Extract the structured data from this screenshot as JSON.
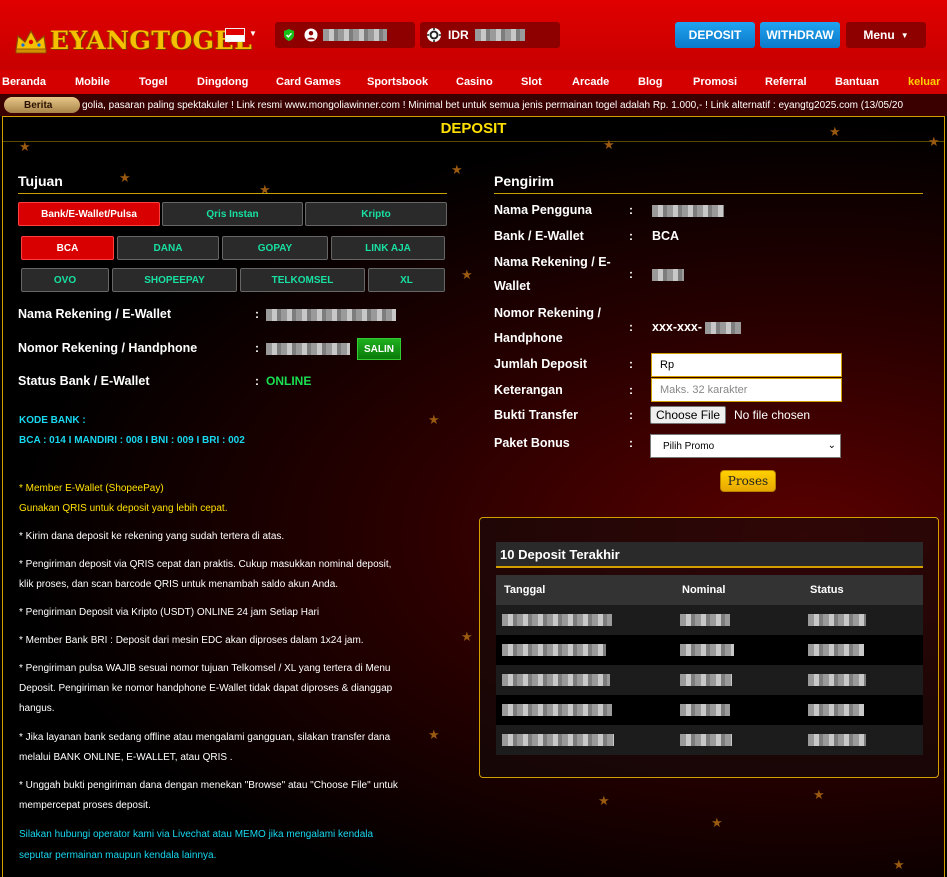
{
  "header": {
    "logo": "EYANGTOGEL",
    "currency": "IDR",
    "deposit_label": "DEPOSIT",
    "withdraw_label": "WITHDRAW",
    "menu_label": "Menu"
  },
  "nav": [
    "Beranda",
    "Mobile",
    "Togel",
    "Dingdong",
    "Card Games",
    "Sportsbook",
    "Casino",
    "Slot",
    "Arcade",
    "Blog",
    "Promosi",
    "Referral",
    "Bantuan",
    "keluar"
  ],
  "ticker": {
    "label": "Berita",
    "message": "golia, pasaran paling spektakuler ! Link resmi www.mongoliawinner.com ! Minimal bet untuk semua jenis permainan togel adalah Rp. 1.000,- ! Link alternatif : eyangtg2025.com    (13/05/20"
  },
  "page": {
    "title": "DEPOSIT"
  },
  "tujuan": {
    "heading": "Tujuan",
    "tabs": [
      "Bank/E-Wallet/Pulsa",
      "Qris Instan",
      "Kripto"
    ],
    "banks_row1": [
      "BCA",
      "DANA",
      "GOPAY",
      "LINK AJA"
    ],
    "banks_row2": [
      "OVO",
      "SHOPEEPAY",
      "TELKOMSEL",
      "XL"
    ],
    "rekening_label": "Nama Rekening / E-Wallet",
    "nomor_label": "Nomor Rekening / Handphone",
    "status_label": "Status Bank / E-Wallet",
    "status_value": "ONLINE",
    "salin_label": "SALIN",
    "colon": ":"
  },
  "info": {
    "kode_bank_title": "KODE BANK :",
    "kode_bank_values": "BCA : 014 I MANDIRI : 008 I BNI : 009 I BRI : 002",
    "member_ewallet": "* Member E-Wallet (ShopeePay)",
    "gunakan_qris": "Gunakan QRIS untuk deposit yang lebih cepat.",
    "notes": [
      "* Kirim dana deposit ke rekening yang sudah tertera di atas.",
      "* Pengiriman deposit via QRIS cepat dan praktis. Cukup masukkan nominal deposit,",
      "klik proses, dan scan barcode QRIS untuk menambah saldo akun Anda.",
      "* Pengiriman Deposit via Kripto (USDT) ONLINE 24 jam Setiap Hari",
      "* Member Bank BRI : Deposit dari mesin EDC akan diproses dalam 1x24 jam.",
      "* Pengiriman pulsa WAJIB sesuai nomor tujuan Telkomsel / XL yang tertera di Menu",
      "Deposit. Pengiriman ke nomor handphone E-Wallet tidak dapat diproses & dianggap",
      "hangus.",
      "* Jika layanan bank sedang offline atau mengalami gangguan, silakan transfer dana",
      "melalui BANK ONLINE, E-WALLET, atau QRIS .",
      "* Unggah bukti pengiriman dana dengan menekan \"Browse\" atau \"Choose File\" untuk",
      "mempercepat proses deposit."
    ],
    "contact": [
      "Silakan hubungi operator kami via Livechat atau MEMO jika mengalami kendala",
      "seputar permainan maupun kendala lainnya."
    ]
  },
  "pengirim": {
    "heading": "Pengirim",
    "nama_pengguna_label": "Nama Pengguna",
    "bank_label": "Bank / E-Wallet",
    "bank_value": "BCA",
    "nama_rekening_label_1": "Nama Rekening / E-",
    "nama_rekening_label_2": "Wallet",
    "nomor_label_1": "Nomor Rekening /",
    "nomor_label_2": "Handphone",
    "nomor_value": "xxx-xxx-",
    "jumlah_label": "Jumlah Deposit",
    "jumlah_value": "Rp",
    "keterangan_label": "Keterangan",
    "keterangan_placeholder": "Maks. 32 karakter",
    "bukti_label": "Bukti Transfer",
    "choose_file": "Choose File",
    "no_file": "No file chosen",
    "paket_label": "Paket Bonus",
    "paket_value": "Pilih Promo",
    "proses_label": "Proses"
  },
  "recent": {
    "title": "10 Deposit Terakhir",
    "columns": [
      "Tanggal",
      "Nominal",
      "Status"
    ]
  }
}
